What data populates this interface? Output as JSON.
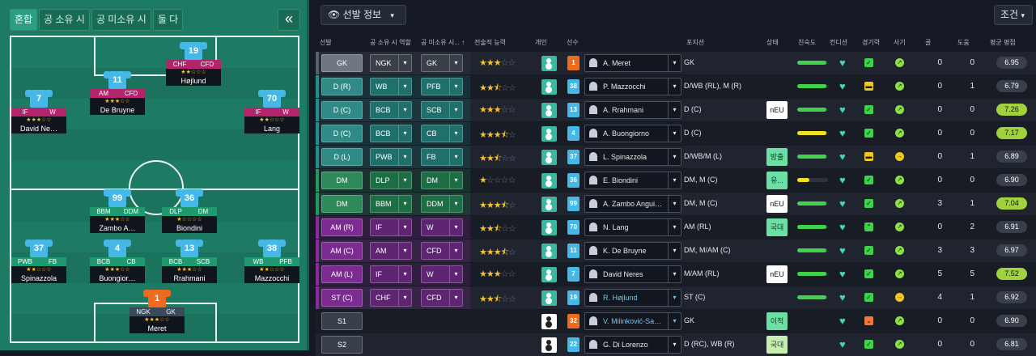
{
  "pitch": {
    "tabs": [
      {
        "label": "혼합",
        "active": true
      },
      {
        "label": "공 소유 시",
        "active": false
      },
      {
        "label": "공 미소유 시",
        "active": false
      },
      {
        "label": "둘 다",
        "active": false
      }
    ],
    "collapse_label": "«",
    "players": [
      {
        "number": "19",
        "r1": "CHF",
        "r2": "CFD",
        "r1c": "mag",
        "r2c": "mag",
        "stars": "★★☆☆☆",
        "name": "Højlund",
        "gk": false
      },
      {
        "number": "11",
        "r1": "AM",
        "r2": "CFD",
        "r1c": "mag",
        "r2c": "mag",
        "stars": "★★★☆☆",
        "name": "De Bruyne",
        "gk": false
      },
      {
        "number": "7",
        "r1": "IF",
        "r2": "W",
        "r1c": "mag",
        "r2c": "mag",
        "stars": "★★★☆☆",
        "name": "David Ne…",
        "gk": false
      },
      {
        "number": "70",
        "r1": "IF",
        "r2": "W",
        "r1c": "mag",
        "r2c": "mag",
        "stars": "★★☆☆☆",
        "name": "Lang",
        "gk": false
      },
      {
        "number": "99",
        "r1": "BBM",
        "r2": "DDM",
        "r1c": "grn",
        "r2c": "grn",
        "stars": "★★★☆☆",
        "name": "Zambo A…",
        "gk": false
      },
      {
        "number": "36",
        "r1": "DLP",
        "r2": "DM",
        "r1c": "grn",
        "r2c": "grn",
        "stars": "★☆☆☆☆",
        "name": "Biondini",
        "gk": false
      },
      {
        "number": "37",
        "r1": "PWB",
        "r2": "FB",
        "r1c": "grn",
        "r2c": "grn",
        "stars": "★★☆☆☆",
        "name": "Spinazzola",
        "gk": false
      },
      {
        "number": "4",
        "r1": "BCB",
        "r2": "CB",
        "r1c": "grn",
        "r2c": "grn",
        "stars": "★★★☆☆",
        "name": "Buongior…",
        "gk": false
      },
      {
        "number": "13",
        "r1": "BCB",
        "r2": "SCB",
        "r1c": "grn",
        "r2c": "grn",
        "stars": "★★★☆☆",
        "name": "Rrahmani",
        "gk": false
      },
      {
        "number": "38",
        "r1": "WB",
        "r2": "PFB",
        "r1c": "grn",
        "r2c": "grn",
        "stars": "★★☆☆☆",
        "name": "Mazzocchi",
        "gk": false
      },
      {
        "number": "1",
        "r1": "NGK",
        "r2": "GK",
        "r1c": "gray",
        "r2c": "gray",
        "stars": "★★★☆☆",
        "name": "Meret",
        "gk": true
      }
    ]
  },
  "toolbar": {
    "view_label": "선발 정보",
    "filter_label": "조건"
  },
  "columns": {
    "lineup": "선발",
    "in_poss": "공 소유 시 역할",
    "out_poss": "공 미소유 시...",
    "tactical": "전술적 능력",
    "personal": "개인",
    "player": "선수",
    "position": "포지션",
    "status": "상태",
    "familiarity": "친숙도",
    "condition": "컨디션",
    "sharpness": "경기력",
    "morale": "사기",
    "goals": "골",
    "assists": "도움",
    "avg_rating": "평균 평점"
  },
  "rows": [
    {
      "pos": "GK",
      "tone": "gray",
      "r1": "NGK",
      "r2": "GK",
      "stars": 3.0,
      "num": "1",
      "gk": true,
      "personal": "teal",
      "name": "A. Meret",
      "hl": false,
      "position": "GK",
      "status": "",
      "status_c": "",
      "fam": 0.95,
      "fam_c": "#3fd24a",
      "sharp": "ok",
      "morale": "good",
      "goals": "0",
      "assists": "0",
      "rating": "6.95",
      "hi": false
    },
    {
      "pos": "D (R)",
      "tone": "teal",
      "r1": "WB",
      "r2": "PFB",
      "stars": 2.5,
      "num": "38",
      "gk": false,
      "personal": "teal",
      "name": "P. Mazzocchi",
      "hl": false,
      "position": "D/WB (RL), M (R)",
      "status": "",
      "status_c": "",
      "fam": 0.95,
      "fam_c": "#3fd24a",
      "sharp": "mid",
      "morale": "good",
      "goals": "0",
      "assists": "1",
      "rating": "6.79",
      "hi": false
    },
    {
      "pos": "D (C)",
      "tone": "teal",
      "r1": "BCB",
      "r2": "SCB",
      "stars": 3.0,
      "num": "13",
      "gk": false,
      "personal": "teal",
      "name": "A. Rrahmani",
      "hl": false,
      "position": "D (C)",
      "status": "nEU",
      "status_c": "w",
      "fam": 0.95,
      "fam_c": "#3fd24a",
      "sharp": "ok",
      "morale": "good",
      "goals": "0",
      "assists": "0",
      "rating": "7.26",
      "hi": true
    },
    {
      "pos": "D (C)",
      "tone": "teal",
      "r1": "BCB",
      "r2": "CB",
      "stars": 3.5,
      "num": "4",
      "gk": false,
      "personal": "teal",
      "name": "A. Buongiorno",
      "hl": false,
      "position": "D (C)",
      "status": "",
      "status_c": "",
      "fam": 0.95,
      "fam_c": "#f0e020",
      "sharp": "ok",
      "morale": "good",
      "goals": "0",
      "assists": "0",
      "rating": "7.17",
      "hi": true
    },
    {
      "pos": "D (L)",
      "tone": "teal",
      "r1": "PWB",
      "r2": "FB",
      "stars": 2.5,
      "num": "37",
      "gk": false,
      "personal": "teal",
      "name": "L. Spinazzola",
      "hl": false,
      "position": "D/WB/M (L)",
      "status": "방출",
      "status_c": "g",
      "fam": 0.95,
      "fam_c": "#3fd24a",
      "sharp": "mid",
      "morale": "ok",
      "goals": "0",
      "assists": "1",
      "rating": "6.89",
      "hi": false
    },
    {
      "pos": "DM",
      "tone": "green",
      "r1": "DLP",
      "r2": "DM",
      "stars": 1.0,
      "num": "36",
      "gk": false,
      "personal": "teal",
      "name": "E. Biondini",
      "hl": false,
      "position": "DM, M (C)",
      "status": "유...",
      "status_c": "g",
      "fam": 0.4,
      "fam_c": "#f0e020",
      "sharp": "ok",
      "morale": "good",
      "goals": "0",
      "assists": "0",
      "rating": "6.90",
      "hi": false
    },
    {
      "pos": "DM",
      "tone": "green",
      "r1": "BBM",
      "r2": "DDM",
      "stars": 3.5,
      "num": "99",
      "gk": false,
      "personal": "teal",
      "name": "A. Zambo Angui…",
      "hl": false,
      "position": "DM, M (C)",
      "status": "nEU",
      "status_c": "w",
      "fam": 0.95,
      "fam_c": "#3fd24a",
      "sharp": "ok",
      "morale": "good",
      "goals": "3",
      "assists": "1",
      "rating": "7.04",
      "hi": true
    },
    {
      "pos": "AM (R)",
      "tone": "purple",
      "r1": "IF",
      "r2": "W",
      "stars": 2.5,
      "num": "70",
      "gk": false,
      "personal": "teal",
      "name": "N. Lang",
      "hl": false,
      "position": "AM (RL)",
      "status": "국대",
      "status_c": "g",
      "fam": 0.95,
      "fam_c": "#3fd24a",
      "sharp": "up",
      "morale": "good",
      "goals": "0",
      "assists": "2",
      "rating": "6.91",
      "hi": false
    },
    {
      "pos": "AM (C)",
      "tone": "purple",
      "r1": "AM",
      "r2": "CFD",
      "stars": 3.5,
      "num": "11",
      "gk": false,
      "personal": "teal",
      "name": "K. De Bruyne",
      "hl": false,
      "position": "DM, M/AM (C)",
      "status": "",
      "status_c": "",
      "fam": 0.95,
      "fam_c": "#3fd24a",
      "sharp": "ok",
      "morale": "good",
      "goals": "3",
      "assists": "3",
      "rating": "6.97",
      "hi": false
    },
    {
      "pos": "AM (L)",
      "tone": "purple",
      "r1": "IF",
      "r2": "W",
      "stars": 3.0,
      "num": "7",
      "gk": false,
      "personal": "teal",
      "name": "David Neres",
      "hl": false,
      "position": "M/AM (RL)",
      "status": "nEU",
      "status_c": "w",
      "fam": 0.95,
      "fam_c": "#3fd24a",
      "sharp": "ok",
      "morale": "good",
      "goals": "5",
      "assists": "5",
      "rating": "7.52",
      "hi": true
    },
    {
      "pos": "ST (C)",
      "tone": "purple",
      "r1": "CHF",
      "r2": "CFD",
      "stars": 2.5,
      "num": "19",
      "gk": false,
      "personal": "teal",
      "name": "R. Højlund",
      "hl": true,
      "position": "ST (C)",
      "status": "",
      "status_c": "",
      "fam": 0.95,
      "fam_c": "#3fd24a",
      "sharp": "ok",
      "morale": "ok",
      "goals": "4",
      "assists": "1",
      "rating": "6.92",
      "hi": false
    },
    {
      "pos": "S1",
      "tone": "none",
      "r1": "",
      "r2": "",
      "stars": -1,
      "num": "32",
      "gk": true,
      "personal": "white",
      "name": "V. Milinković-Sa…",
      "hl": true,
      "position": "GK",
      "status": "이적",
      "status_c": "g",
      "fam": 0,
      "fam_c": "",
      "sharp": "low",
      "morale": "good",
      "goals": "0",
      "assists": "0",
      "rating": "6.90",
      "hi": false
    },
    {
      "pos": "S2",
      "tone": "none",
      "r1": "",
      "r2": "",
      "stars": -1,
      "num": "22",
      "gk": false,
      "personal": "white",
      "name": "G. Di Lorenzo",
      "hl": false,
      "position": "D (RC), WB (R)",
      "status": "국대",
      "status_c": "gy",
      "fam": 0,
      "fam_c": "",
      "sharp": "ok",
      "morale": "good",
      "goals": "0",
      "assists": "0",
      "rating": "6.81",
      "hi": false
    }
  ]
}
